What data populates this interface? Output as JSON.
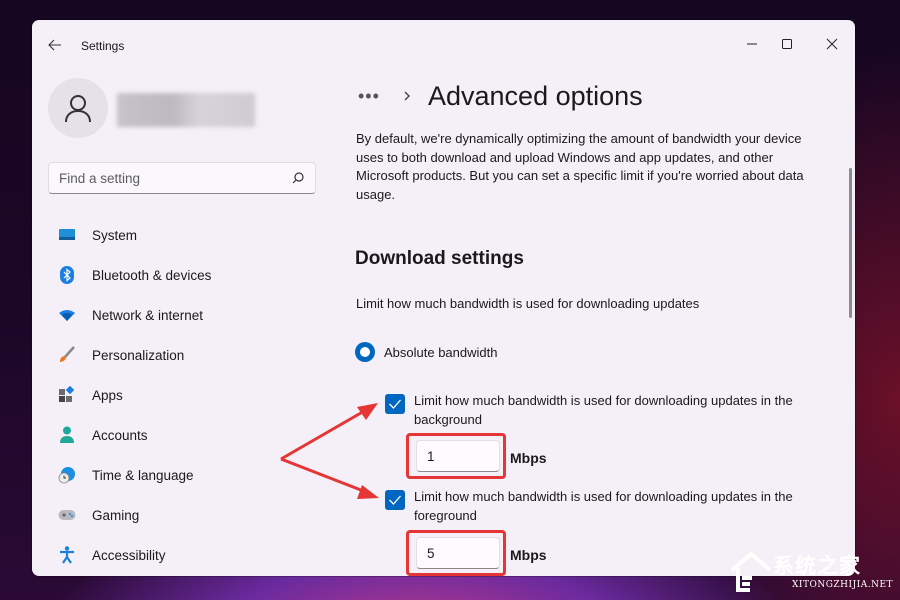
{
  "window": {
    "title": "Settings",
    "controls": {
      "minimize": "minimize",
      "maximize": "maximize",
      "close": "close"
    }
  },
  "sidebar": {
    "search": {
      "placeholder": "Find a setting",
      "value": ""
    },
    "items": [
      {
        "label": "System",
        "icon": "system-icon"
      },
      {
        "label": "Bluetooth & devices",
        "icon": "bluetooth-icon"
      },
      {
        "label": "Network & internet",
        "icon": "wifi-icon"
      },
      {
        "label": "Personalization",
        "icon": "brush-icon"
      },
      {
        "label": "Apps",
        "icon": "apps-icon"
      },
      {
        "label": "Accounts",
        "icon": "person-icon"
      },
      {
        "label": "Time & language",
        "icon": "globe-clock-icon"
      },
      {
        "label": "Gaming",
        "icon": "gamepad-icon"
      },
      {
        "label": "Accessibility",
        "icon": "accessibility-icon"
      }
    ]
  },
  "content": {
    "breadcrumb_more": "•••",
    "title": "Advanced options",
    "description": "By default, we're dynamically optimizing the amount of bandwidth your device uses to both download and upload Windows and app updates, and other Microsoft products. But you can set a specific limit if you're worried about data usage.",
    "section_title": "Download settings",
    "limit_label": "Limit how much bandwidth is used for downloading updates",
    "radio": {
      "label": "Absolute bandwidth",
      "selected": true
    },
    "background": {
      "label": "Limit how much bandwidth is used for downloading updates in the background",
      "checked": true,
      "value": "1",
      "unit": "Mbps"
    },
    "foreground": {
      "label": "Limit how much bandwidth is used for downloading updates in the foreground",
      "checked": true,
      "value": "5",
      "unit": "Mbps"
    }
  },
  "annotations": {
    "arrow_color": "#e53535",
    "highlight_color": "#e53535"
  },
  "accent_color": "#0067c0",
  "watermark": {
    "text_cn": "系统之家",
    "text_en": "XITONGZHIJIA.NET"
  }
}
